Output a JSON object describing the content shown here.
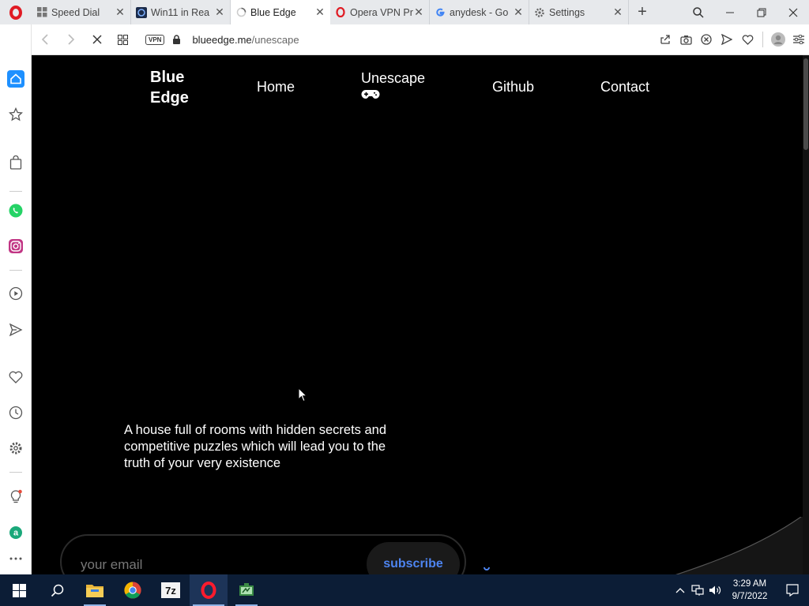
{
  "browser": {
    "tabs": [
      {
        "title": "Speed Dial",
        "icon": "speed-dial-icon",
        "active": false
      },
      {
        "title": "Win11 in Rea",
        "icon": "win11-favicon",
        "active": false
      },
      {
        "title": "Blue Edge",
        "icon": "loading-spinner-icon",
        "active": true
      },
      {
        "title": "Opera VPN Pr",
        "icon": "opera-favicon",
        "active": false
      },
      {
        "title": "anydesk - Go",
        "icon": "google-favicon",
        "active": false
      },
      {
        "title": "Settings",
        "icon": "gear-icon",
        "active": false
      }
    ],
    "address": {
      "vpn_label": "VPN",
      "domain": "blueedge.me",
      "path": "/unescape"
    }
  },
  "site": {
    "brand": "Blue Edge",
    "nav": {
      "home": "Home",
      "unescape": "Unescape",
      "github": "Github",
      "contact": "Contact"
    },
    "tagline": "A house full of rooms with hidden secrets and competitive puzzles which will lead you to the truth of your very existence",
    "subscribe": {
      "placeholder": "your email",
      "button": "subscribe"
    },
    "accent_color": "#4d84f0"
  },
  "taskbar": {
    "time": "3:29 AM",
    "date": "9/7/2022",
    "apps": [
      "file-explorer-icon",
      "chrome-icon",
      "7zip-icon",
      "opera-icon",
      "app-icon"
    ]
  }
}
